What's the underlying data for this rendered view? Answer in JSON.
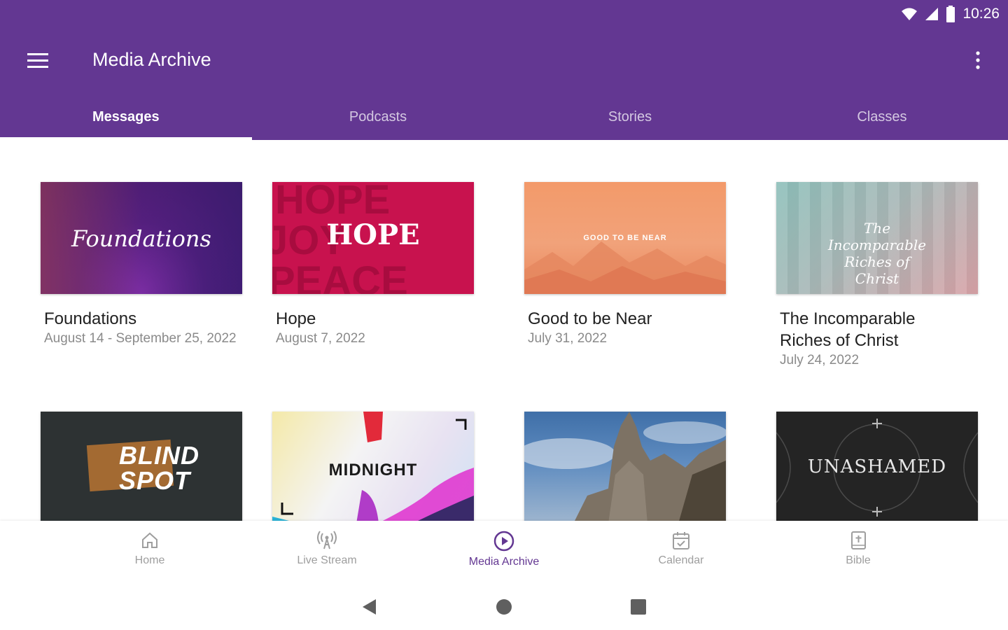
{
  "status": {
    "time": "10:26"
  },
  "toolbar": {
    "title": "Media Archive"
  },
  "tabs": [
    {
      "label": "Messages",
      "active": true
    },
    {
      "label": "Podcasts",
      "active": false
    },
    {
      "label": "Stories",
      "active": false
    },
    {
      "label": "Classes",
      "active": false
    }
  ],
  "cards": [
    {
      "title": "Foundations",
      "date": "August 14 - September 25, 2022",
      "art_text": "Foundations"
    },
    {
      "title": "Hope",
      "date": "August 7, 2022",
      "art_text": "HOPE",
      "bg_words": [
        "HOPE",
        "JOY",
        "PEACE"
      ]
    },
    {
      "title": "Good to be Near",
      "date": "July 31, 2022",
      "art_text": "GOOD TO BE NEAR"
    },
    {
      "title": "The Incomparable Riches of Christ",
      "date": "July 24, 2022",
      "art_text": "The Incomparable Riches of Christ"
    },
    {
      "art_text_line1": "BLIND",
      "art_text_line2": "SPOT"
    },
    {
      "art_text": "MIDNIGHT"
    },
    {},
    {
      "art_text": "UNASHAMED"
    }
  ],
  "bottom_nav": [
    {
      "label": "Home",
      "icon": "home-icon"
    },
    {
      "label": "Live Stream",
      "icon": "broadcast-icon"
    },
    {
      "label": "Media Archive",
      "icon": "play-circle-icon",
      "active": true
    },
    {
      "label": "Calendar",
      "icon": "calendar-icon"
    },
    {
      "label": "Bible",
      "icon": "bible-icon"
    }
  ],
  "colors": {
    "primary": "#633792",
    "inactive": "#9e9e9e"
  }
}
